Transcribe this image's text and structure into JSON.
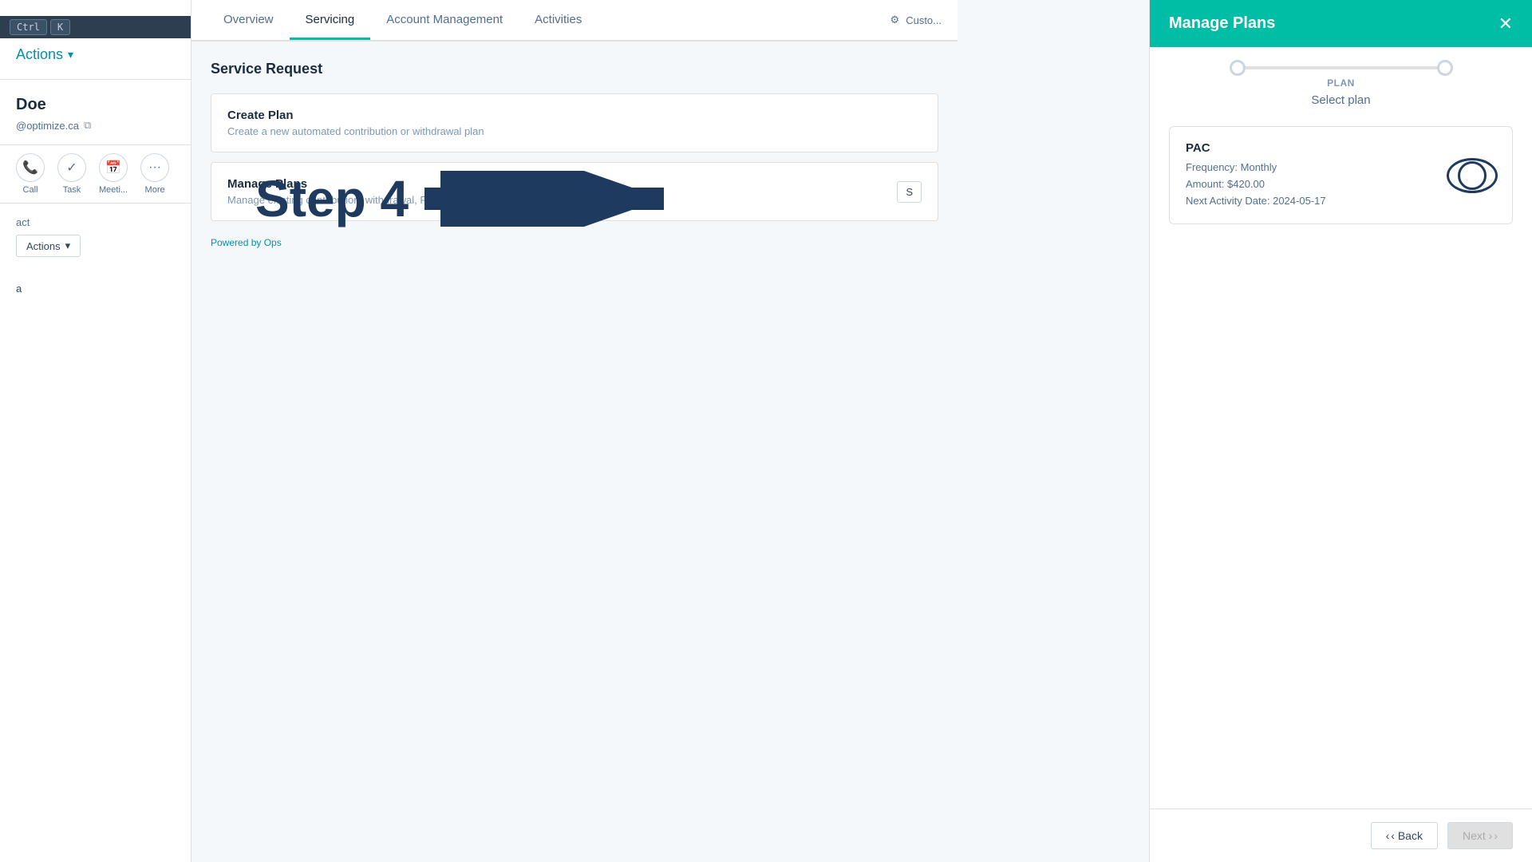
{
  "sidebar": {
    "keyboard_bar": {
      "ctrl_label": "Ctrl",
      "k_label": "K"
    },
    "actions_top_label": "Actions",
    "actions_chevron": "▾",
    "contact": {
      "name": "Doe",
      "email": "@optimize.ca"
    },
    "action_buttons": [
      {
        "id": "call",
        "icon": "📞",
        "label": "Call"
      },
      {
        "id": "task",
        "icon": "✓",
        "label": "Task"
      },
      {
        "id": "meeting",
        "icon": "📅",
        "label": "Meeti..."
      },
      {
        "id": "more",
        "icon": "···",
        "label": "More"
      }
    ],
    "contact_section_label": "act",
    "actions_btn_label": "Actions",
    "bottom_label": "a"
  },
  "tabs": {
    "items": [
      {
        "id": "overview",
        "label": "Overview",
        "active": false
      },
      {
        "id": "servicing",
        "label": "Servicing",
        "active": true
      },
      {
        "id": "account-management",
        "label": "Account Management",
        "active": false
      },
      {
        "id": "activities",
        "label": "Activities",
        "active": false
      }
    ],
    "customize_label": "Custo..."
  },
  "content": {
    "section_title": "Service Request",
    "cards": [
      {
        "id": "create-plan",
        "title": "Create Plan",
        "description": "Create a new automated contribution or withdrawal plan"
      },
      {
        "id": "manage-plans",
        "title": "Manage Plans",
        "description": "Manage existing contribution, withdrawal, RIF or LIF plans",
        "btn_label": "S"
      }
    ],
    "powered_by_prefix": "Powered by ",
    "powered_by_link": "Ops"
  },
  "step4": {
    "text": "Step 4"
  },
  "modal": {
    "title": "Manage Plans",
    "close_icon": "✕",
    "progress": {
      "step_label": "PLAN",
      "step_sublabel": "Select plan"
    },
    "plan_card": {
      "name": "PAC",
      "frequency": "Frequency: Monthly",
      "amount": "Amount: $420.00",
      "next_activity": "Next Activity Date: 2024-05-17"
    },
    "footer": {
      "back_label": "‹ Back",
      "next_label": "Next ›"
    }
  }
}
